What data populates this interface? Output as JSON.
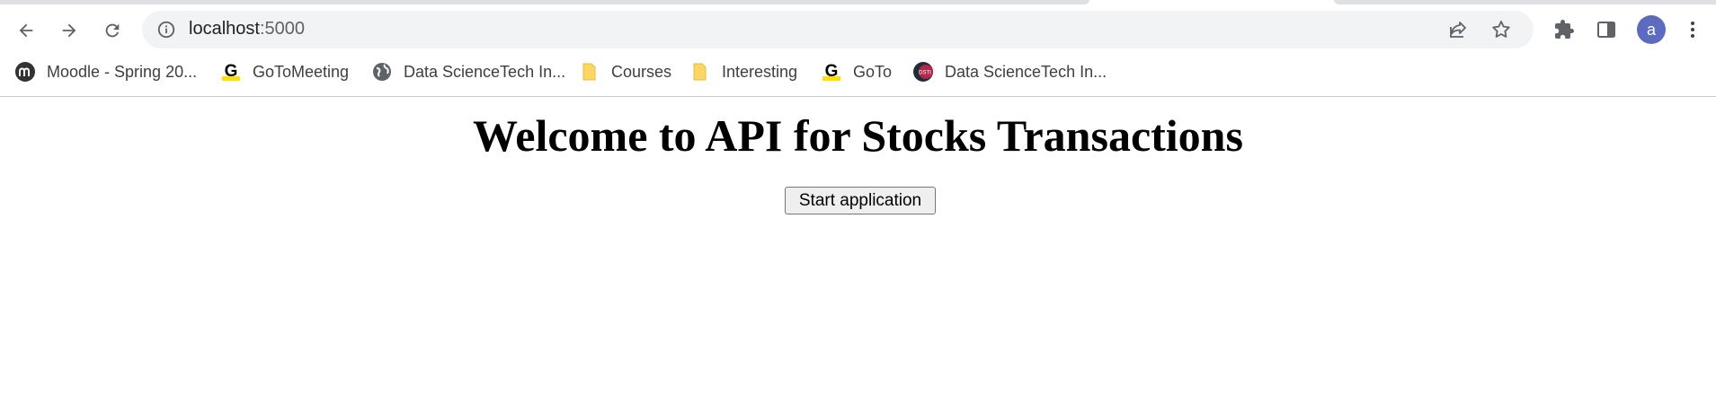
{
  "browser": {
    "url_host": "localhost",
    "url_port": ":5000",
    "profile_initial": "a",
    "bookmarks": [
      {
        "label": "Moodle - Spring 20...",
        "icon": "moodle-icon"
      },
      {
        "label": "GoToMeeting",
        "icon": "gotomeeting-icon"
      },
      {
        "label": "Data ScienceTech In...",
        "icon": "globe-icon"
      },
      {
        "label": "Courses",
        "icon": "folder-icon"
      },
      {
        "label": "Interesting",
        "icon": "folder-icon"
      },
      {
        "label": "GoTo",
        "icon": "goto-icon"
      },
      {
        "label": "Data ScienceTech In...",
        "icon": "dsti-icon"
      }
    ]
  },
  "page": {
    "heading": "Welcome to API for Stocks Transactions",
    "start_button": "Start application"
  },
  "colors": {
    "omnibox_bg": "#f1f3f4",
    "avatar_bg": "#5c6bc0",
    "folder_yellow": "#fdd663",
    "goto_yellow": "#ffe000"
  }
}
